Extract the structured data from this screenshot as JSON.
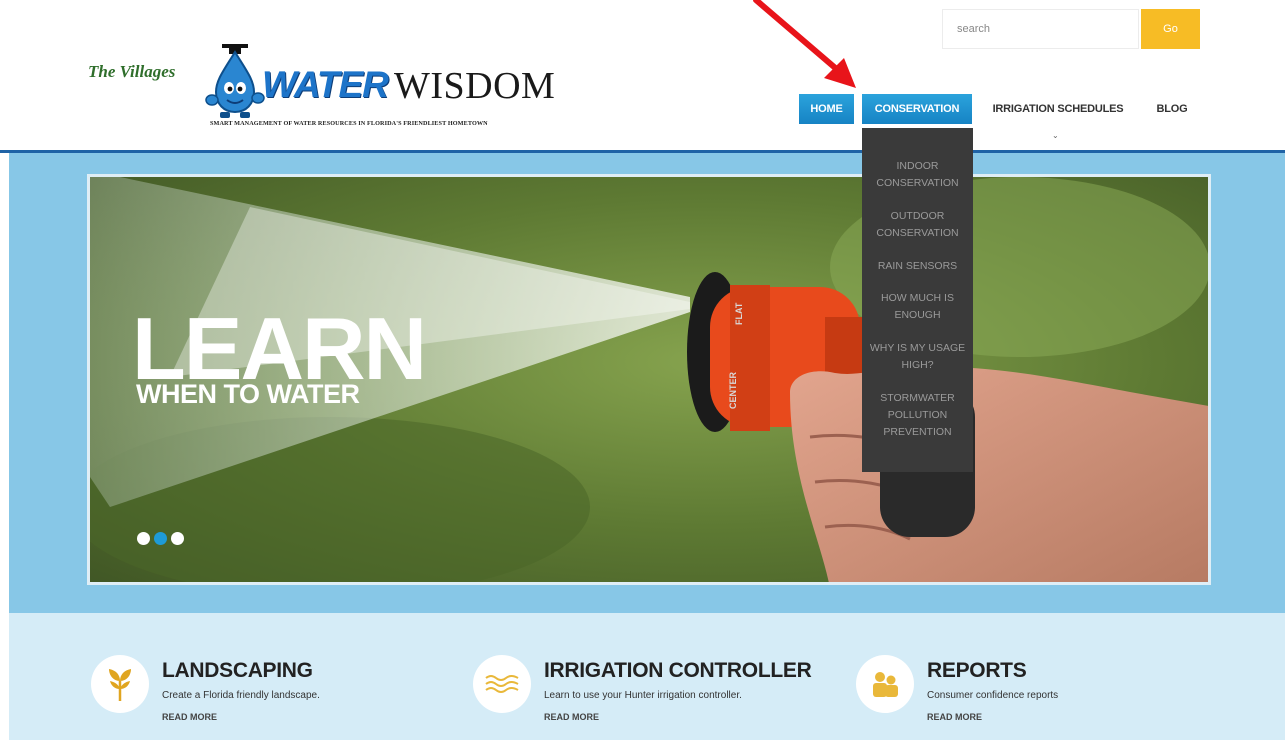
{
  "logo": {
    "villages": "The Villages",
    "water": "WATER",
    "wisdom": "WISDOM",
    "tagline": "SMART MANAGEMENT OF WATER RESOURCES IN FLORIDA'S FRIENDLIEST HOMETOWN"
  },
  "search": {
    "placeholder": "search",
    "button": "Go"
  },
  "nav": {
    "home": "HOME",
    "conservation": "CONSERVATION",
    "irrigation": "IRRIGATION SCHEDULES",
    "blog": "BLOG",
    "caret": "⌄"
  },
  "dropdown": [
    {
      "label": "INDOOR CONSERVATION"
    },
    {
      "label": "OUTDOOR CONSERVATION"
    },
    {
      "label": "RAIN SENSORS"
    },
    {
      "label": "HOW MUCH IS ENOUGH"
    },
    {
      "label": "WHY IS MY USAGE HIGH?"
    },
    {
      "label": "STORMWATER POLLUTION PREVENTION"
    }
  ],
  "hero": {
    "headline": "LEARN",
    "subheadline": "WHEN TO WATER",
    "nozzle_text_1": "CENTER",
    "nozzle_text_2": "FLAT",
    "slides": 3,
    "active_slide": 2
  },
  "features": [
    {
      "title": "LANDSCAPING",
      "description": "Create a Florida friendly landscape.",
      "link": "READ MORE",
      "icon": "plant-icon"
    },
    {
      "title": "IRRIGATION CONTROLLER",
      "description": "Learn to use your Hunter irrigation controller.",
      "link": "READ MORE",
      "icon": "water-waves-icon"
    },
    {
      "title": "REPORTS",
      "description": "Consumer confidence reports",
      "link": "READ MORE",
      "icon": "people-icon"
    }
  ],
  "colors": {
    "nav_blue": "#1683c4",
    "accent_yellow": "#f7bc25",
    "hero_band": "#87c7e7",
    "features_band": "#d5ecf7",
    "dropdown_bg": "#3a3a3a",
    "annotation_red": "#e8141a"
  }
}
